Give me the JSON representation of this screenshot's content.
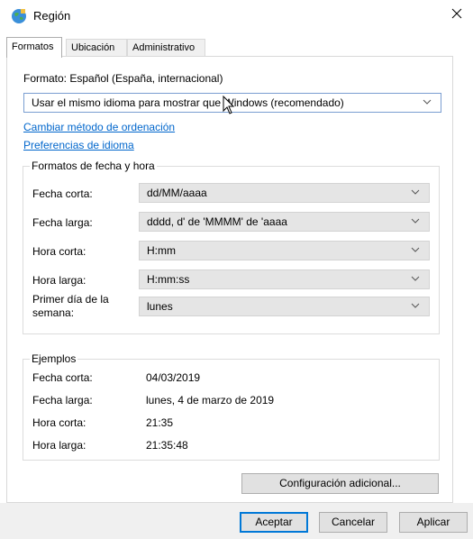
{
  "window": {
    "title": "Región",
    "icon": "globe-icon",
    "close_glyph": "✕"
  },
  "tabs": [
    {
      "label": "Formatos",
      "active": true
    },
    {
      "label": "Ubicación",
      "active": false
    },
    {
      "label": "Administrativo",
      "active": false
    }
  ],
  "format": {
    "label": "Formato: Español (España, internacional)",
    "selected": "Usar el mismo idioma para mostrar que Windows (recomendado)"
  },
  "links": {
    "sort": "Cambiar método de ordenación",
    "language": "Preferencias de idioma"
  },
  "date_time_group": {
    "legend": "Formatos de fecha y hora",
    "rows": [
      {
        "label": "Fecha corta:",
        "value": "dd/MM/aaaa"
      },
      {
        "label": "Fecha larga:",
        "value": "dddd, d' de 'MMMM' de 'aaaa"
      },
      {
        "label": "Hora corta:",
        "value": "H:mm"
      },
      {
        "label": "Hora larga:",
        "value": "H:mm:ss"
      }
    ],
    "first_day_label_line1": "Primer día de la",
    "first_day_label_line2": "semana:",
    "first_day_value": "lunes"
  },
  "examples": {
    "legend": "Ejemplos",
    "rows": [
      {
        "label": "Fecha corta:",
        "value": "04/03/2019"
      },
      {
        "label": "Fecha larga:",
        "value": "lunes, 4 de marzo de 2019"
      },
      {
        "label": "Hora corta:",
        "value": "21:35"
      },
      {
        "label": "Hora larga:",
        "value": "21:35:48"
      }
    ]
  },
  "buttons": {
    "additional": "Configuración adicional...",
    "ok": "Aceptar",
    "cancel": "Cancelar",
    "apply": "Aplicar"
  },
  "colors": {
    "link": "#0066cc",
    "focus_border": "#0078d7",
    "combo_bg": "#e5e5e5",
    "footer_bg": "#f0f0f0"
  }
}
